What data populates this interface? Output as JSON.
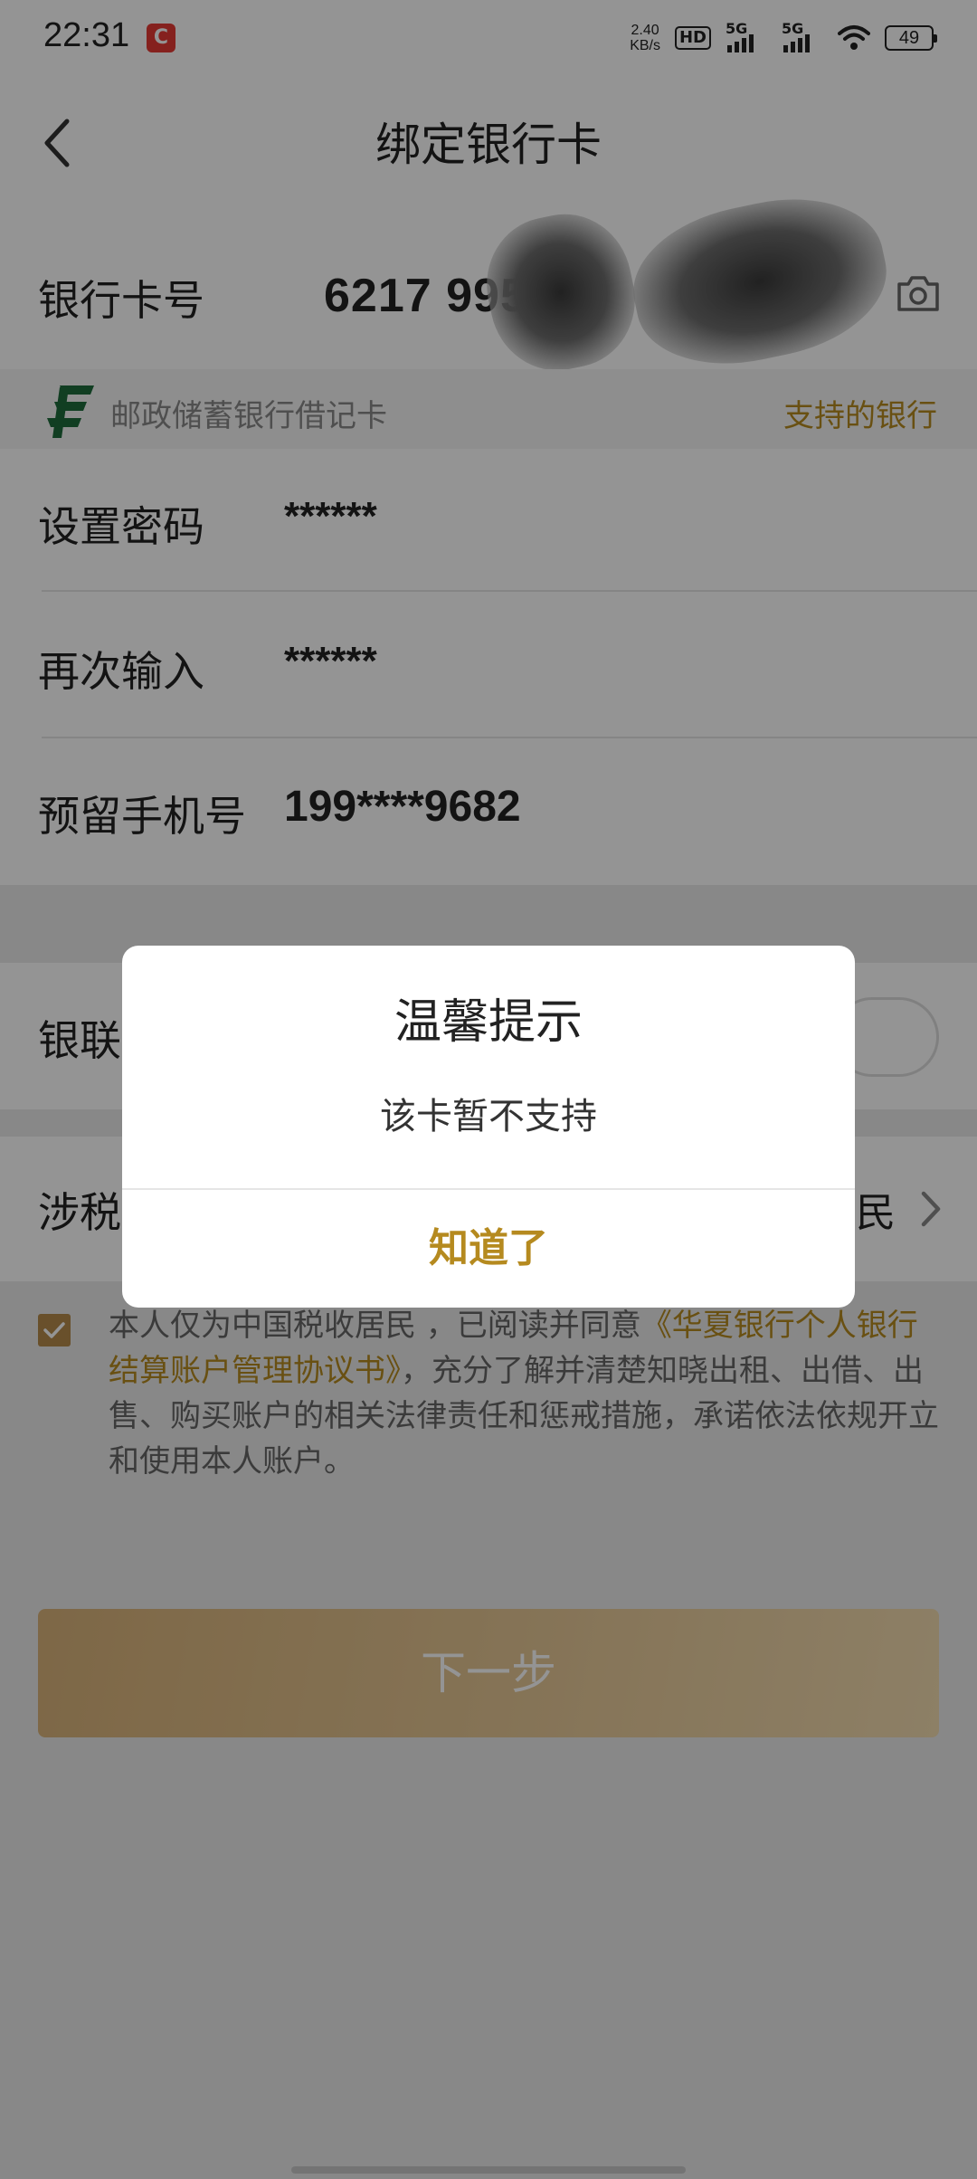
{
  "status_bar": {
    "time": "22:31",
    "net_speed_value": "2.40",
    "net_speed_unit": "KB/s",
    "hd_label": "HD",
    "sim1_label": "5G",
    "sim2_label": "5G",
    "battery": "49"
  },
  "header": {
    "title": "绑定银行卡"
  },
  "card": {
    "label": "银行卡号",
    "number_visible": "6217 995"
  },
  "bank": {
    "name": "邮政储蓄银行借记卡",
    "supported_link": "支持的银行"
  },
  "form": {
    "password_label": "设置密码",
    "password_value": "******",
    "confirm_label": "再次输入",
    "confirm_value": "******",
    "phone_label": "预留手机号",
    "phone_value": "199****9682"
  },
  "unionpay": {
    "label_visible": "银联"
  },
  "tax": {
    "label_visible": "涉税",
    "value_visible": "民"
  },
  "agreement": {
    "prefix": "本人仅为中国税收居民 ，已阅读并同意",
    "link": "《华夏银行个人银行结算账户管理协议书》",
    "suffix": "，充分了解并清楚知晓出租、出借、出售、购买账户的相关法律责任和惩戒措施，承诺依法依规开立和使用本人账户。"
  },
  "next_button": {
    "label": "下一步"
  },
  "dialog": {
    "title": "温馨提示",
    "message": "该卡暂不支持",
    "ok_label": "知道了"
  },
  "colors": {
    "accent": "#b58a1f",
    "button_gradient_start": "#d9b37a",
    "button_gradient_end": "#f3dcb0",
    "bank_logo_green": "#1e6b3c"
  }
}
